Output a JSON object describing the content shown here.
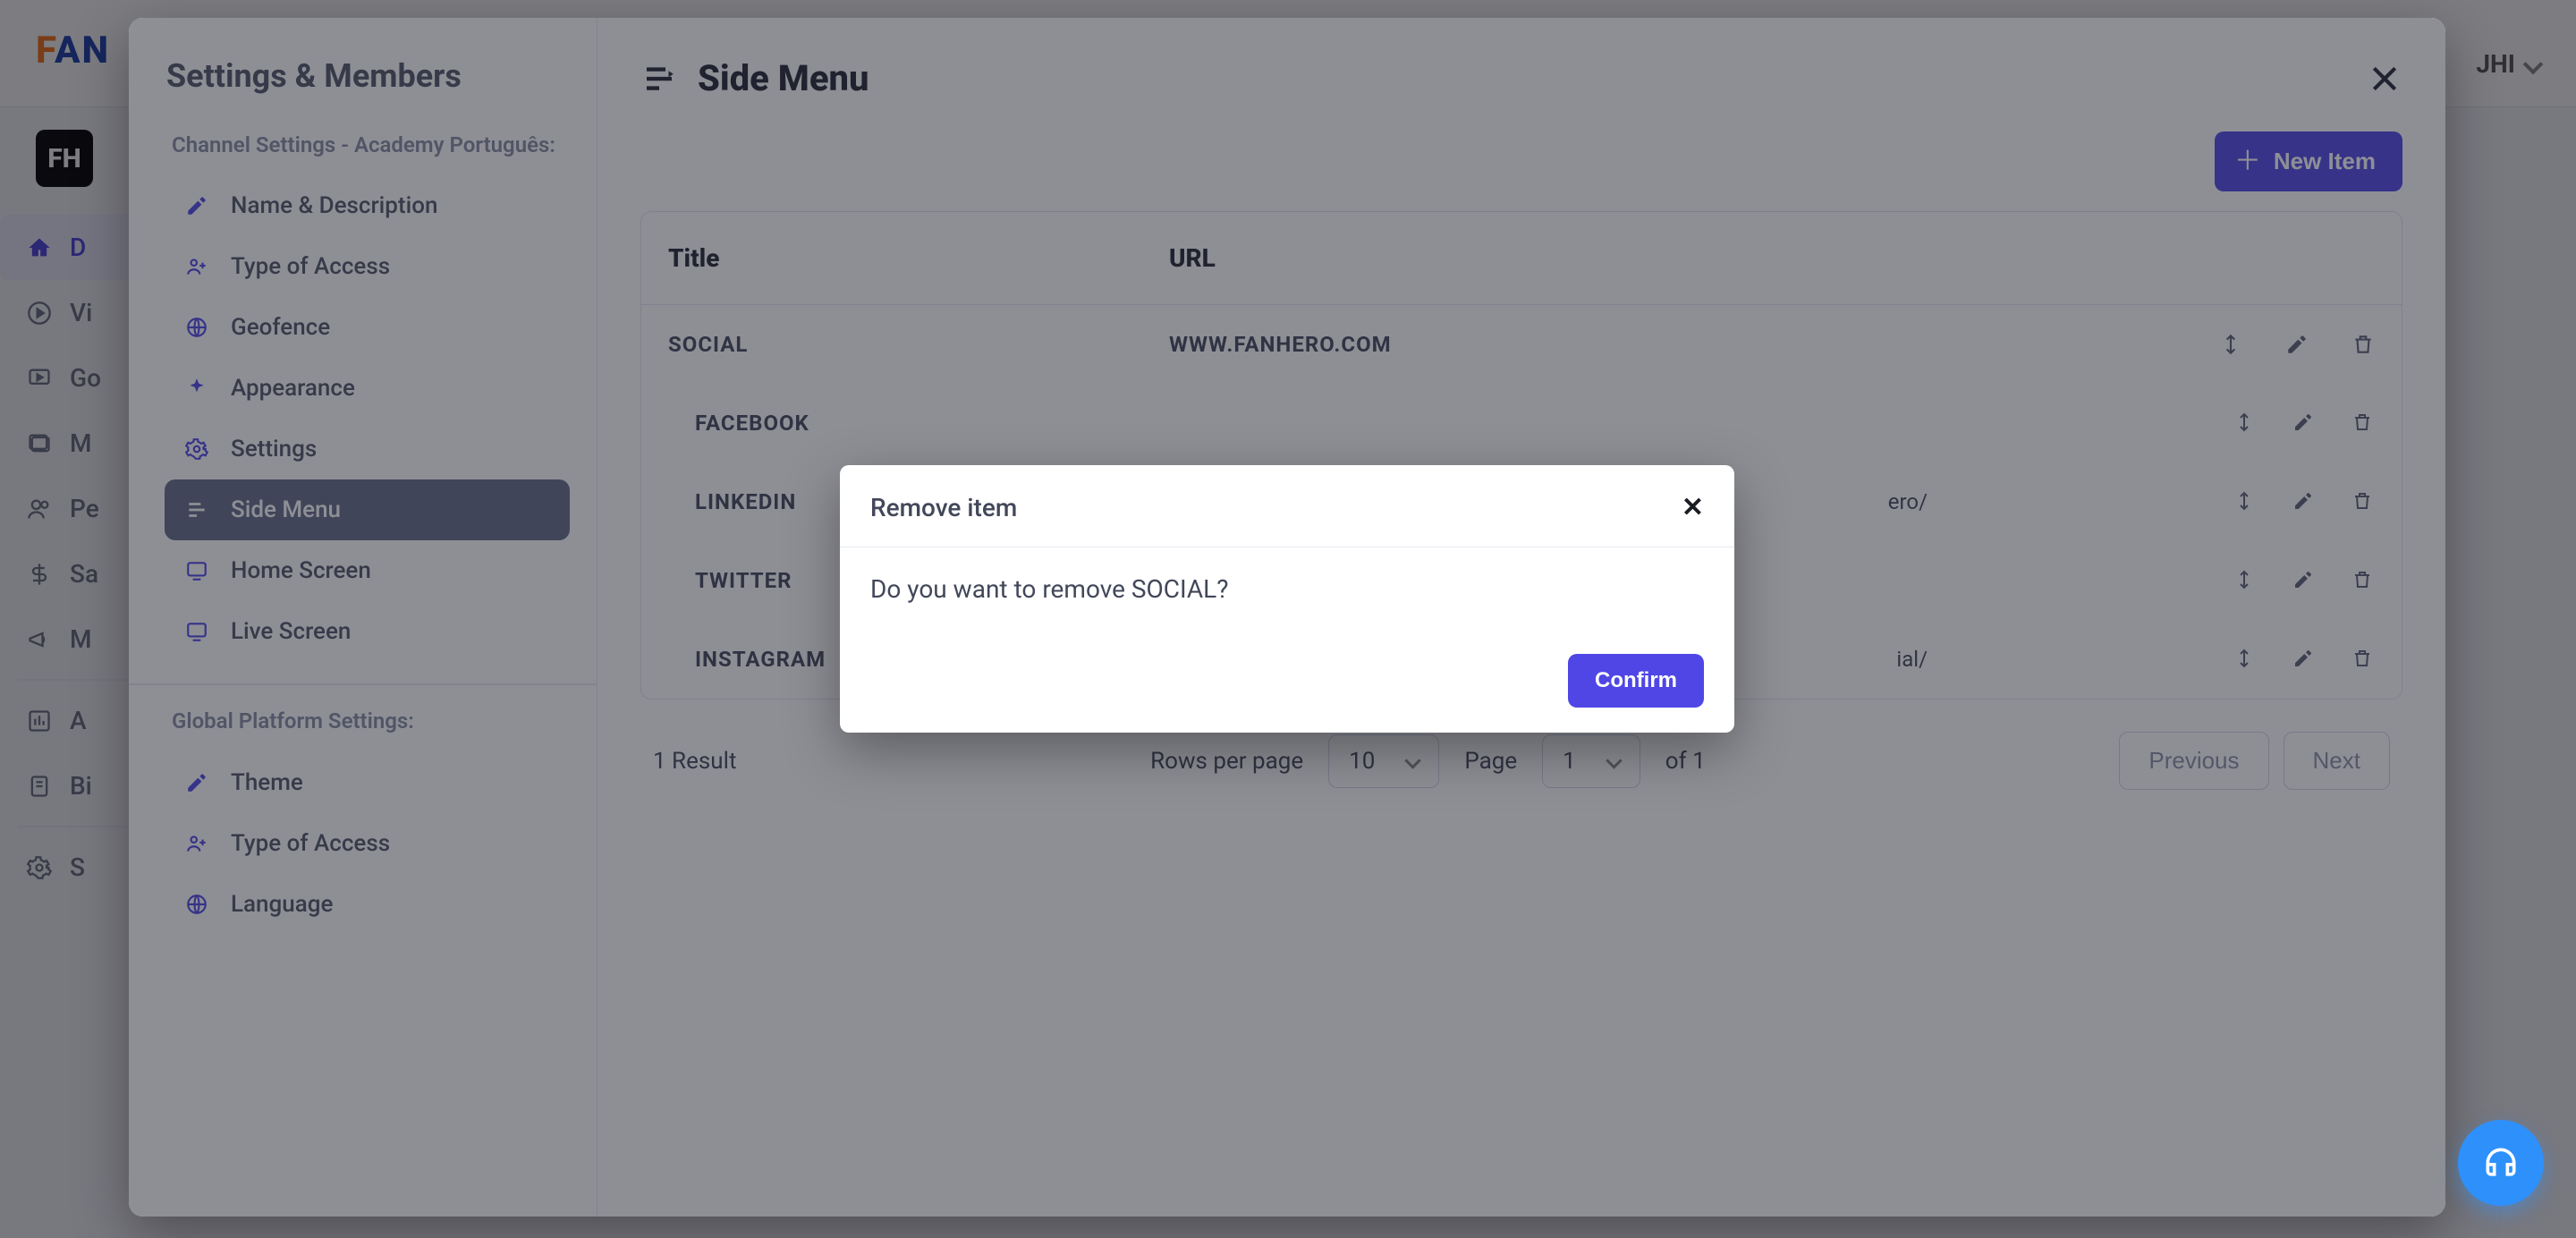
{
  "brand": {
    "initial": "F",
    "rest": "AN",
    "avatar_text": "FH"
  },
  "topbar": {
    "user": "JHI"
  },
  "nav": {
    "items": [
      {
        "key": "dashboard",
        "label": "D",
        "active": true
      },
      {
        "key": "videos",
        "label": "Vi"
      },
      {
        "key": "goals",
        "label": "Go"
      },
      {
        "key": "media",
        "label": "M"
      },
      {
        "key": "people",
        "label": "Pe"
      },
      {
        "key": "sales",
        "label": "Sa"
      },
      {
        "key": "marketing",
        "label": "M"
      },
      {
        "key": "analytics",
        "label": "A"
      },
      {
        "key": "billing",
        "label": "Bi"
      },
      {
        "key": "settings",
        "label": "S"
      }
    ]
  },
  "sheet": {
    "title": "Settings & Members",
    "section_channel": "Channel Settings - Academy Português:",
    "section_global": "Global Platform Settings:",
    "channel_items": [
      {
        "key": "name-description",
        "label": "Name & Description"
      },
      {
        "key": "type-of-access",
        "label": "Type of Access"
      },
      {
        "key": "geofence",
        "label": "Geofence"
      },
      {
        "key": "appearance",
        "label": "Appearance"
      },
      {
        "key": "settings",
        "label": "Settings"
      },
      {
        "key": "side-menu",
        "label": "Side Menu",
        "active": true
      },
      {
        "key": "home-screen",
        "label": "Home Screen"
      },
      {
        "key": "live-screen",
        "label": "Live Screen"
      }
    ],
    "global_items": [
      {
        "key": "theme",
        "label": "Theme"
      },
      {
        "key": "global-type-of-access",
        "label": "Type of Access"
      },
      {
        "key": "language",
        "label": "Language"
      }
    ]
  },
  "main": {
    "title": "Side Menu",
    "new_item_label": "New Item",
    "columns": {
      "title": "Title",
      "url": "URL"
    },
    "rows": [
      {
        "kind": "parent",
        "title": "SOCIAL",
        "url": "WWW.FANHERO.COM"
      },
      {
        "kind": "child",
        "title": "FACEBOOK",
        "url": ""
      },
      {
        "kind": "child",
        "title": "LINKEDIN",
        "url": "ero/"
      },
      {
        "kind": "child",
        "title": "TWITTER",
        "url": ""
      },
      {
        "kind": "child",
        "title": "INSTAGRAM",
        "url": "ial/"
      }
    ],
    "footer": {
      "result": "1 Result",
      "rows_per_page": "Rows per page",
      "rows_value": "10",
      "page_label": "Page",
      "page_value": "1",
      "page_of": "of 1",
      "prev": "Previous",
      "next": "Next"
    }
  },
  "dialog": {
    "title": "Remove item",
    "body": "Do you want to remove SOCIAL?",
    "confirm": "Confirm"
  }
}
